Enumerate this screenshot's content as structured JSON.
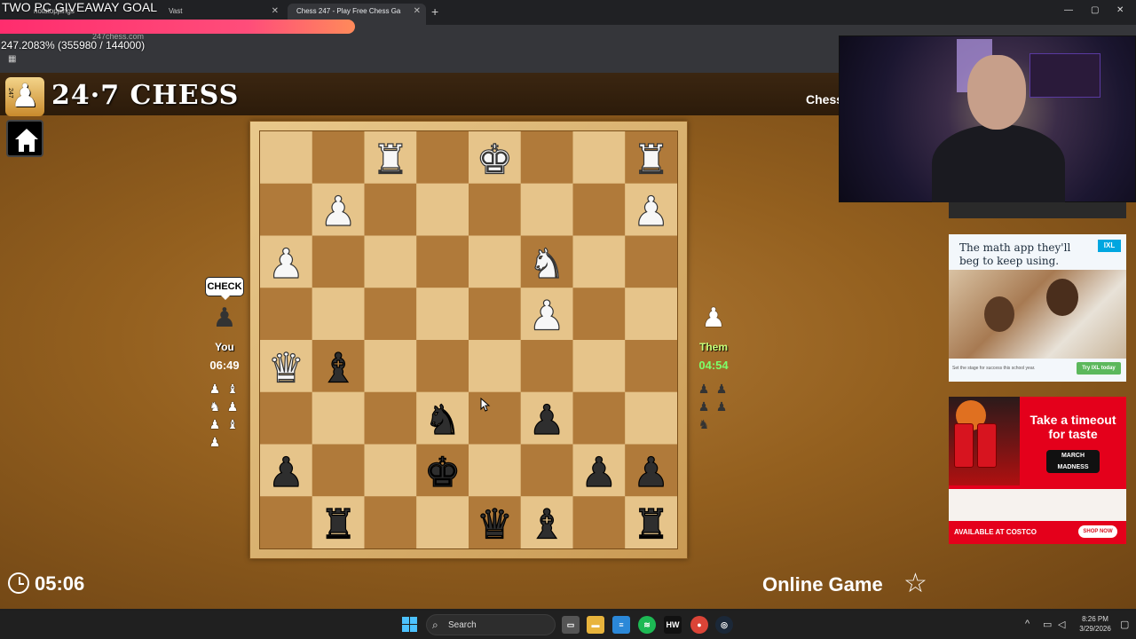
{
  "browser": {
    "tabs": [
      {
        "label": "notatoppings",
        "active": false
      },
      {
        "label": "Vast",
        "active": false
      },
      {
        "label": "Chess 247 - Play Free Chess Ga",
        "active": true
      }
    ],
    "url": "247chess.com"
  },
  "overlay": {
    "giveaway": "TWO PC GIVEAWAY GOAL",
    "goal_progress_text": "247.2083% (355980 / 144000)"
  },
  "site": {
    "logo_number": "247",
    "title": "24·7 CHESS",
    "header_right": "Chess"
  },
  "board": {
    "ranks": [
      [
        "",
        "",
        "wR",
        "",
        "wK",
        "",
        "",
        "wR"
      ],
      [
        "",
        "wP",
        "",
        "",
        "",
        "",
        "",
        "wP"
      ],
      [
        "wP",
        "",
        "",
        "",
        "",
        "wN",
        "",
        ""
      ],
      [
        "",
        "",
        "",
        "",
        "",
        "wP",
        "",
        ""
      ],
      [
        "wQ",
        "bB",
        "",
        "",
        "",
        "",
        "",
        ""
      ],
      [
        "",
        "",
        "",
        "bN",
        "",
        "bP",
        "",
        ""
      ],
      [
        "bP",
        "",
        "",
        "bK",
        "",
        "",
        "bP",
        "bP"
      ],
      [
        "",
        "bR",
        "",
        "",
        "bQ",
        "bB",
        "",
        "bR"
      ]
    ]
  },
  "player_you": {
    "status_bubble": "CHECK",
    "label": "You",
    "time": "06:49",
    "captured": [
      [
        "wP",
        "wB"
      ],
      [
        "wN",
        "wP"
      ],
      [
        "wP",
        "wB"
      ],
      [
        "wP"
      ]
    ]
  },
  "player_them": {
    "label": "Them",
    "time": "04:54",
    "captured": [
      [
        "bP",
        "bP"
      ],
      [
        "bP",
        "bP"
      ],
      [
        "bN"
      ]
    ]
  },
  "footer": {
    "game_timer": "05:06",
    "mode": "Online Game"
  },
  "ads": {
    "ixl": {
      "headline": "The math app they'll beg to keep using.",
      "badge": "IXL",
      "footnote": "Set the stage for success this school year.",
      "cta": "Try IXL today"
    },
    "coke": {
      "headline": "Take a timeout for taste",
      "badge": "MARCH MADNESS",
      "availability": "AVAILABLE AT COSTCO",
      "cta": "SHOP NOW"
    }
  },
  "taskbar": {
    "search_placeholder": "Search",
    "time": "8:26 PM",
    "date": "3/29/2026"
  },
  "colors": {
    "light_square": "#e6c48a",
    "dark_square": "#b07a3a",
    "them_clock": "#7dff6a"
  }
}
